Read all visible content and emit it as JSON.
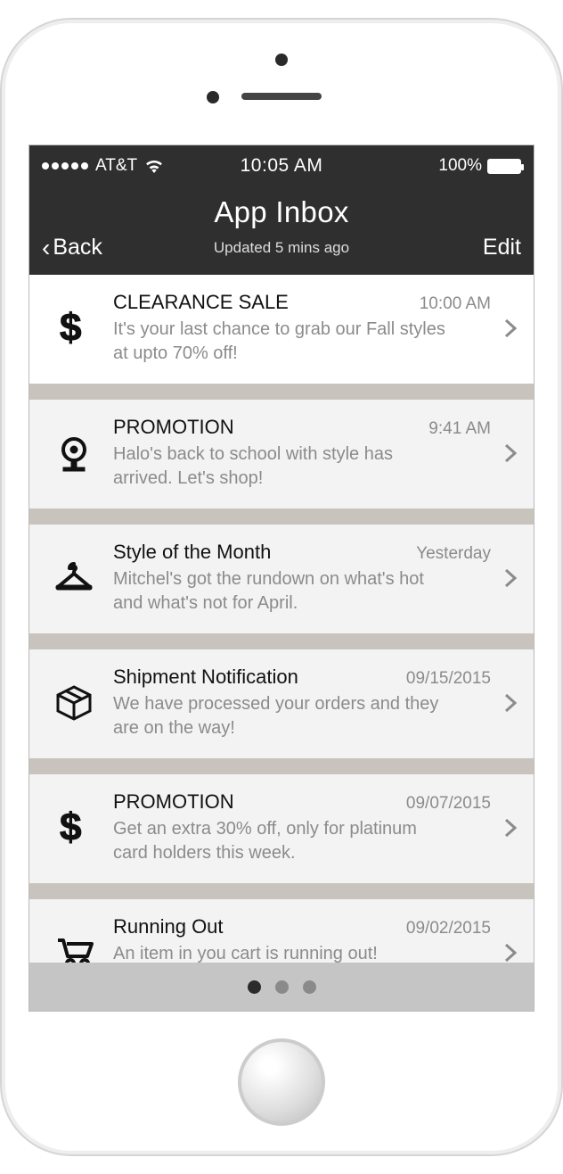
{
  "statusbar": {
    "carrier": "AT&T",
    "time": "10:05 AM",
    "battery_pct": "100%"
  },
  "header": {
    "title": "App Inbox",
    "updated": "Updated 5 mins ago",
    "back_label": "Back",
    "edit_label": "Edit"
  },
  "messages": [
    {
      "icon": "dollar",
      "title": "CLEARANCE SALE",
      "time": "10:00 AM",
      "desc": "It's your last chance to grab our Fall styles at upto 70% off!"
    },
    {
      "icon": "bell",
      "title": "PROMOTION",
      "time": "9:41 AM",
      "desc": "Halo's back to school with style has arrived. Let's shop!"
    },
    {
      "icon": "hanger",
      "title": "Style of the Month",
      "time": "Yesterday",
      "desc": "Mitchel's got the rundown on what's hot and what's not for April."
    },
    {
      "icon": "box",
      "title": "Shipment Notification",
      "time": "09/15/2015",
      "desc": "We have processed your orders and they are on the way!"
    },
    {
      "icon": "dollar",
      "title": "PROMOTION",
      "time": "09/07/2015",
      "desc": "Get an extra 30% off, only for platinum card holders this week."
    },
    {
      "icon": "cart",
      "title": "Running Out",
      "time": "09/02/2015",
      "desc": "An item in you cart is running out! Purchase it, before it's too late."
    }
  ],
  "pager": {
    "count": 3,
    "active": 0
  }
}
